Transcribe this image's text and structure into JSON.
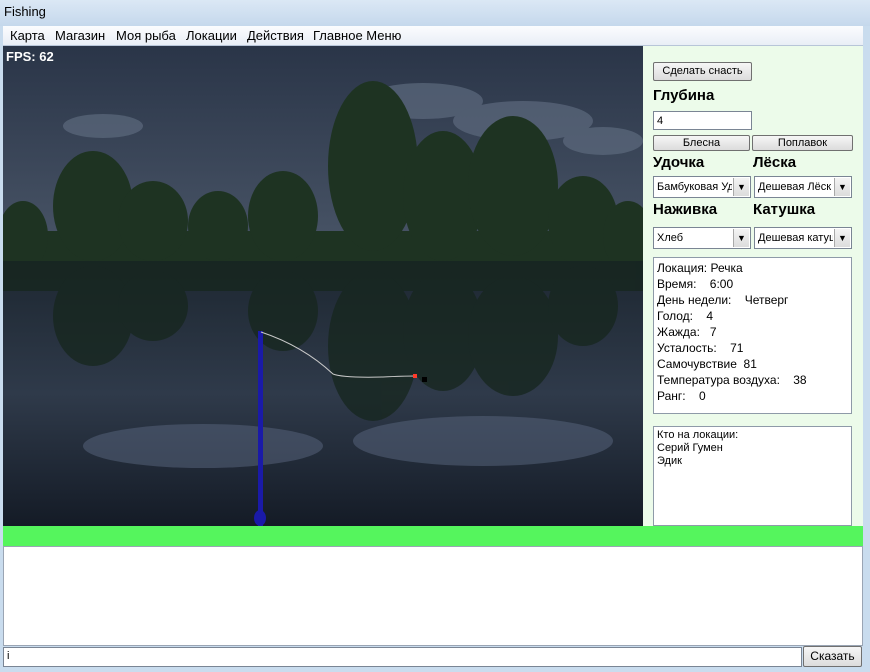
{
  "window": {
    "title": "Fishing"
  },
  "menu": [
    "Карта",
    "Магазин",
    "Моя рыба",
    "Локации",
    "Действия",
    "Главное Меню"
  ],
  "game": {
    "fps_label": "FPS: 62"
  },
  "panel": {
    "make_tackle_button": "Сделать снасть",
    "depth_header": "Глубина",
    "depth_value": "4",
    "lure_button": "Блесна",
    "float_button": "Поплавок",
    "rod_header": "Удочка",
    "line_header": "Лёска",
    "rod_value": "Бамбуковая Уд",
    "line_value": "Дешевая Лёск",
    "bait_header": "Наживка",
    "reel_header": "Катушка",
    "bait_value": "Хлеб",
    "reel_value": "Дешевая катуш"
  },
  "stats": [
    "Локация: Речка",
    "Время:    6:00",
    "День недели:    Четверг",
    "Голод:    4",
    "Жажда:   7",
    "Усталость:    71",
    "Самочувствие  81",
    "Температура воздуха:    38",
    "Ранг:    0"
  ],
  "who": {
    "title": "Кто на локации:",
    "players": [
      "Серий Гумен",
      "Эдик"
    ]
  },
  "chat": {
    "input_value": "i",
    "send_button": "Сказать"
  },
  "colors": {
    "panel_bg": "#ecfbea",
    "progress": "#55f55d",
    "rod": "#1a1aa8"
  }
}
